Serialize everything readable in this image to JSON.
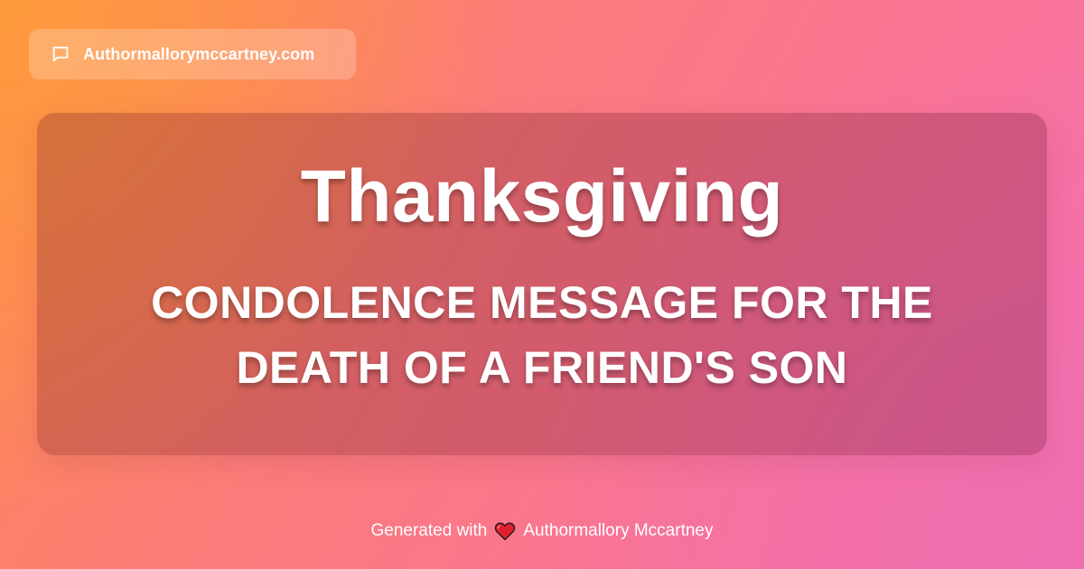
{
  "site": {
    "icon": "chat-bubble-icon",
    "name": "Authormallorymccartney.com"
  },
  "card": {
    "headline": "Thanksgiving",
    "subtitle": "CONDOLENCE MESSAGE FOR THE DEATH OF A FRIEND'S SON"
  },
  "footer": {
    "prefix": "Generated with",
    "icon": "heart-icon",
    "author": "Authormallory Mccartney"
  },
  "colors": {
    "gradient_start": "#ff9a3d",
    "gradient_end": "#f56fae",
    "text": "#ffffff",
    "heart": "#e0202e"
  }
}
